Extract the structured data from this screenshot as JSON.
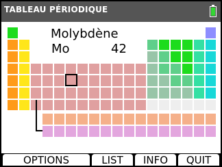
{
  "titlebar": {
    "title": "TABLEAU PÉRIODIQUE",
    "battery": {
      "icon": "battery-icon",
      "color": "#33d633"
    }
  },
  "element": {
    "name": "Molybdène",
    "symbol": "Mo",
    "atomic_number": "42"
  },
  "menu": {
    "options": "OPTIONS",
    "list": "LIST",
    "info": "INFO",
    "quit": "QUIT"
  },
  "colors": {
    "alkali": "#ff9b1a",
    "alkaline_earth": "#ffe61a",
    "transition": "#e0a0a0",
    "post_transition": "#98c5a8",
    "metalloid": "#5fcf8a",
    "nonmetal": "#1ddc1d",
    "halogen": "#33e0a3",
    "noble_gas": "#18d8d8",
    "unknown": "#eeeeee",
    "lanthanide": "#f5b08a",
    "actinide": "#e3a6de",
    "hydrogen": "#1ddc1d",
    "helium": "#8d8dff"
  }
}
